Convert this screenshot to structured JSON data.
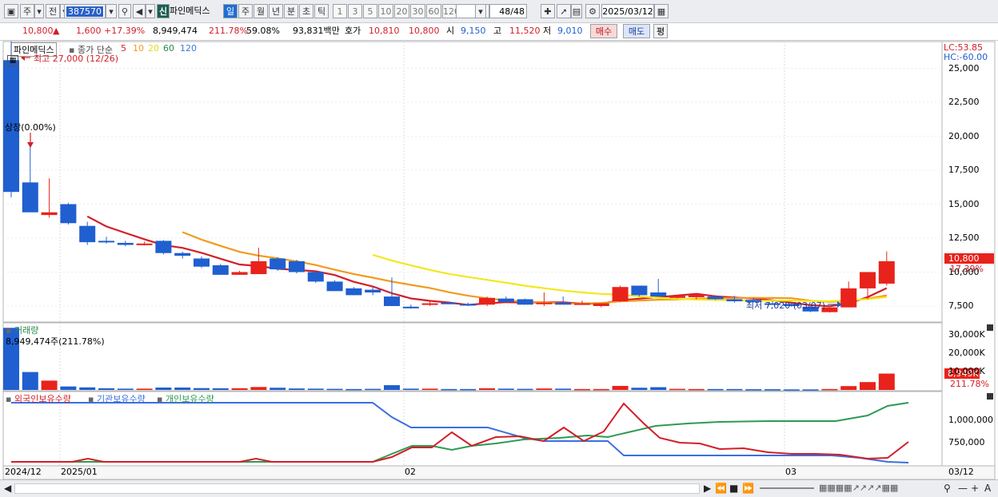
{
  "toolbar": {
    "period_main": "주",
    "prev_label": "전",
    "code": "387570",
    "stock_badge": "신",
    "stock_name": "파인메딕스",
    "periods": [
      "일",
      "주",
      "월",
      "년",
      "분",
      "초",
      "틱"
    ],
    "selected_period": "일",
    "intervals": [
      "1",
      "3",
      "5",
      "10",
      "20",
      "30",
      "60",
      "120"
    ],
    "page_counter": "48",
    "page_total": "/48",
    "date": "2025/03/12"
  },
  "quote": {
    "price": "10,800",
    "change_arrow": "▲",
    "change": "1,600",
    "change_pct": "+17.39%",
    "volume": "8,949,474",
    "volume_ratio": "211.78%",
    "turnover": "59.08%",
    "amount": "93,831백만",
    "hoga_label": "호가",
    "hoga_ask": "10,810",
    "hoga_bid": "10,800",
    "open_label": "시",
    "open": "9,150",
    "high_label": "고",
    "high": "11,520",
    "low_label": "저",
    "low": "9,010",
    "buy_label": "매수",
    "sell_label": "매도",
    "eval_label": "평"
  },
  "price_panel": {
    "legend_name": "파인메딕스",
    "legend_ma_title": "종가 단순",
    "ma_periods": [
      "5",
      "10",
      "20",
      "60",
      "120"
    ],
    "max_label": "최고 27,000 (12/26)",
    "event_label": "상장(0.00%)",
    "min_label": "최저 7,020 (03/07)",
    "lc_label": "LC:53.85",
    "hc_label": "HC:-60.00",
    "current_price_tag": "10,800",
    "current_pct_tag": "17.39%",
    "y_ticks": [
      "25,000",
      "22,500",
      "20,000",
      "17,500",
      "15,000",
      "12,500",
      "10,000",
      "7,500"
    ]
  },
  "volume_panel": {
    "title": "거래량",
    "value_label": "8,949,474주(211.78%)",
    "y_ticks": [
      "30,000K",
      "20,000K",
      "10,000K"
    ],
    "tag_value": "8,949K",
    "tag_pct": "211.78%"
  },
  "holding_panel": {
    "legend": [
      "외국인보유수량",
      "기관보유수량",
      "개인보유수량"
    ],
    "y_ticks": [
      "1,000,000",
      "750,000"
    ]
  },
  "x_axis": {
    "labels": [
      "2024/12",
      "2025/01",
      "02",
      "03"
    ],
    "right_label": "03/12"
  },
  "colors": {
    "up": "#e8231b",
    "down": "#1f5fd0",
    "ma5": "#d21f28",
    "ma10": "#f29a1d",
    "ma20": "#f2e81d",
    "ma60": "#2a8a4a",
    "ma120": "#3a7ad0",
    "foreign": "#d21f28",
    "institution": "#3a6fe0",
    "individual": "#2f9a55"
  },
  "chart_data": {
    "type": "candlestick",
    "dates": [
      "12/26",
      "12/27",
      "12/30",
      "01/02",
      "01/03",
      "01/06",
      "01/07",
      "01/08",
      "01/09",
      "01/10",
      "01/13",
      "01/14",
      "01/15",
      "01/16",
      "01/17",
      "01/20",
      "01/21",
      "01/22",
      "01/23",
      "01/24",
      "02/03",
      "02/04",
      "02/05",
      "02/06",
      "02/07",
      "02/10",
      "02/11",
      "02/12",
      "02/13",
      "02/14",
      "02/17",
      "02/18",
      "02/19",
      "02/20",
      "02/21",
      "02/24",
      "02/25",
      "02/26",
      "02/27",
      "02/28",
      "03/04",
      "03/05",
      "03/06",
      "03/07",
      "03/10",
      "03/11",
      "03/12"
    ],
    "ohlc": [
      [
        25600,
        27000,
        15500,
        15900
      ],
      [
        16600,
        19500,
        14500,
        14400
      ],
      [
        14200,
        16900,
        14000,
        14400
      ],
      [
        15000,
        15100,
        13500,
        13600
      ],
      [
        13400,
        13700,
        12000,
        12200
      ],
      [
        12300,
        12600,
        12100,
        12200
      ],
      [
        12150,
        12300,
        11900,
        12000
      ],
      [
        12050,
        12250,
        11950,
        12100
      ],
      [
        12300,
        12350,
        11300,
        11400
      ],
      [
        11400,
        11500,
        11000,
        11200
      ],
      [
        11000,
        11150,
        10300,
        10400
      ],
      [
        10500,
        10600,
        9800,
        9800
      ],
      [
        9800,
        10100,
        9800,
        10000
      ],
      [
        9850,
        11800,
        9850,
        10800
      ],
      [
        11000,
        11100,
        10100,
        10200
      ],
      [
        10800,
        10900,
        9900,
        10000
      ],
      [
        10000,
        10100,
        9200,
        9300
      ],
      [
        9300,
        9400,
        8600,
        8600
      ],
      [
        8800,
        8900,
        8300,
        8300
      ],
      [
        8700,
        8900,
        8300,
        8500
      ],
      [
        8200,
        9600,
        7600,
        7500
      ],
      [
        7450,
        7600,
        7300,
        7400
      ],
      [
        7600,
        7900,
        7500,
        7700
      ],
      [
        7750,
        7800,
        7650,
        7700
      ],
      [
        7650,
        7750,
        7550,
        7600
      ],
      [
        7600,
        8200,
        7500,
        8100
      ],
      [
        8050,
        8200,
        7750,
        7800
      ],
      [
        8000,
        8050,
        7600,
        7600
      ],
      [
        7700,
        8500,
        7500,
        7750
      ],
      [
        7750,
        8200,
        7700,
        7600
      ],
      [
        7650,
        7900,
        7600,
        7700
      ],
      [
        7500,
        7700,
        7400,
        7700
      ],
      [
        7850,
        9000,
        7800,
        8900
      ],
      [
        9000,
        9000,
        8200,
        8300
      ],
      [
        8500,
        9500,
        8200,
        8200
      ],
      [
        8100,
        8300,
        8050,
        8250
      ],
      [
        8150,
        8300,
        8000,
        8350
      ],
      [
        8200,
        8300,
        7950,
        8000
      ],
      [
        8000,
        8250,
        7750,
        7850
      ],
      [
        7950,
        8100,
        7750,
        7800
      ],
      [
        7700,
        7850,
        7600,
        7600
      ],
      [
        7650,
        7750,
        7450,
        7500
      ],
      [
        7450,
        7500,
        7050,
        7100
      ],
      [
        7050,
        7200,
        7020,
        7400
      ],
      [
        7400,
        9300,
        7400,
        8800
      ],
      [
        8800,
        10000,
        8000,
        10000
      ],
      [
        9150,
        11520,
        9010,
        10800
      ]
    ],
    "volume_k": [
      34000,
      9800,
      5100,
      1900,
      1400,
      900,
      700,
      700,
      1300,
      1300,
      1000,
      900,
      900,
      1600,
      1200,
      800,
      700,
      600,
      500,
      600,
      2600,
      700,
      700,
      500,
      500,
      900,
      700,
      600,
      800,
      700,
      500,
      500,
      2200,
      1200,
      1500,
      600,
      500,
      500,
      500,
      400,
      400,
      300,
      300,
      500,
      2100,
      4300,
      8949
    ],
    "y_range": [
      6500,
      26500
    ],
    "volume_range": [
      0,
      35000
    ]
  }
}
